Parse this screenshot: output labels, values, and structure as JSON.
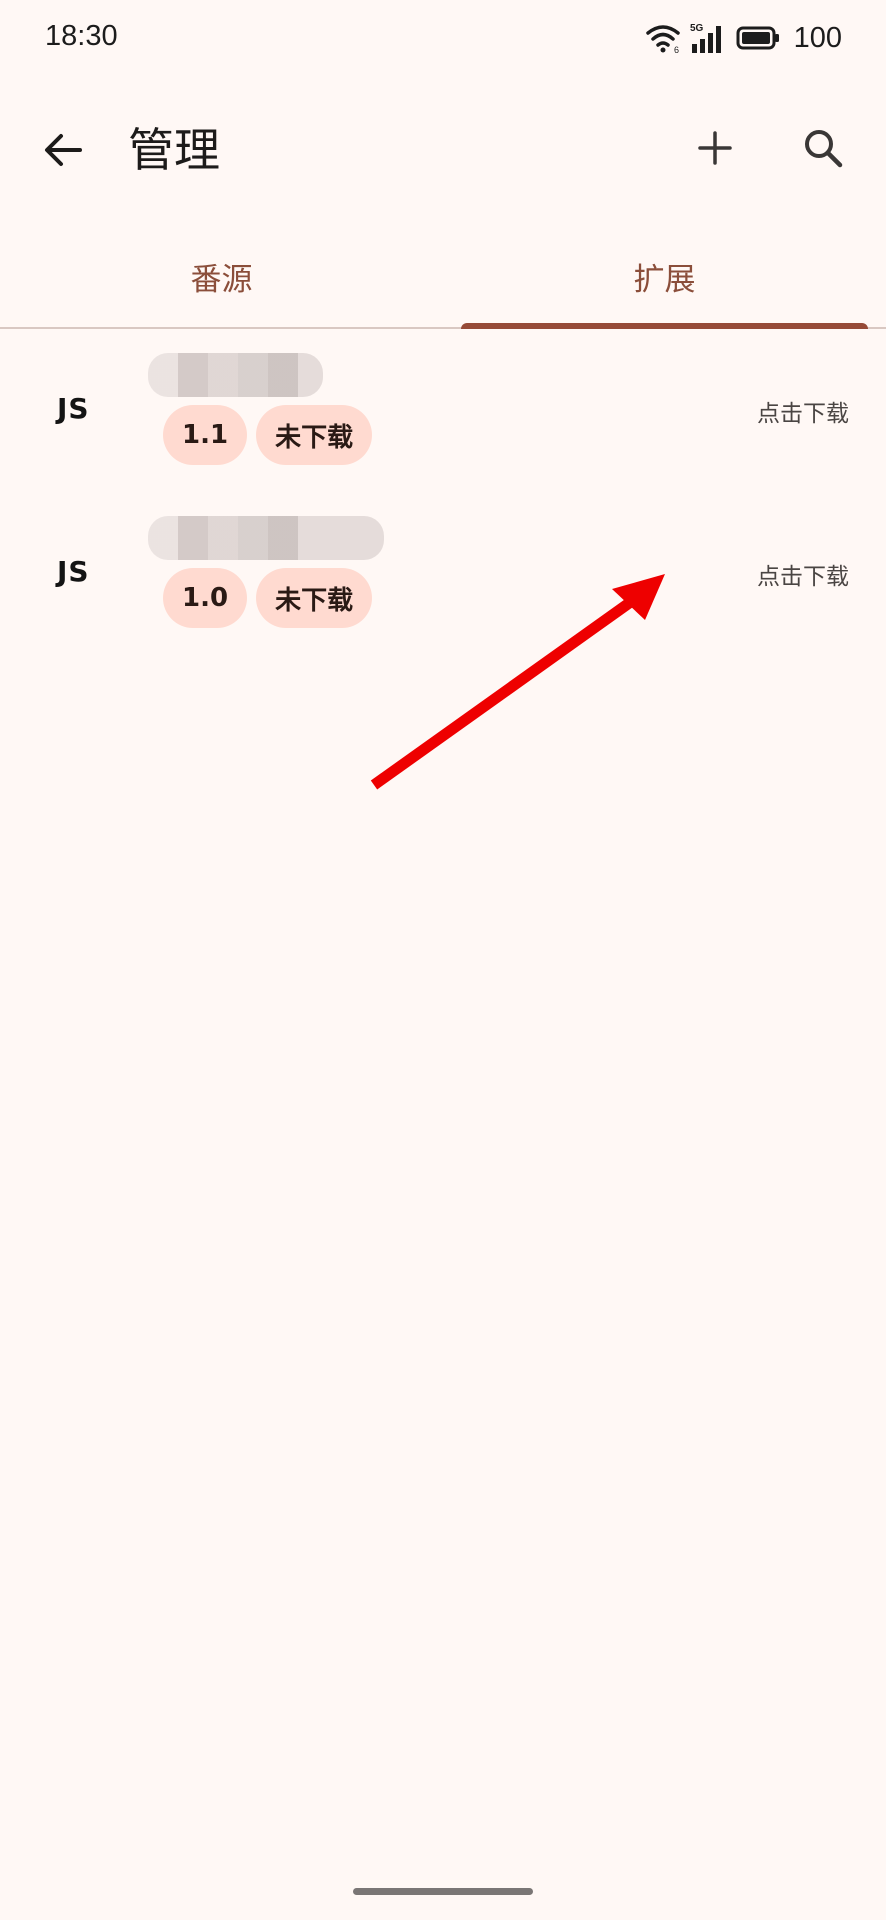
{
  "status_bar": {
    "time": "18:30",
    "network_label": "5G",
    "wifi_badge": "6",
    "battery": "100",
    "icons": [
      "wifi-icon",
      "cellular-signal-icon",
      "battery-icon"
    ]
  },
  "app_bar": {
    "title": "管理",
    "icons": {
      "back": "arrow-back-icon",
      "add": "plus-icon",
      "search": "search-icon"
    }
  },
  "tabs": [
    {
      "label": "番源",
      "selected": false
    },
    {
      "label": "扩展",
      "selected": true
    }
  ],
  "extensions": [
    {
      "type_badge": "JS",
      "version": "1.1",
      "status": "未下载",
      "action": "点击下载"
    },
    {
      "type_badge": "JS",
      "version": "1.0",
      "status": "未下载",
      "action": "点击下载"
    }
  ],
  "colors": {
    "background": "#fff8f5",
    "accent": "#964a37",
    "chip": "#ffdad0",
    "annotation_arrow": "#ee0000"
  }
}
